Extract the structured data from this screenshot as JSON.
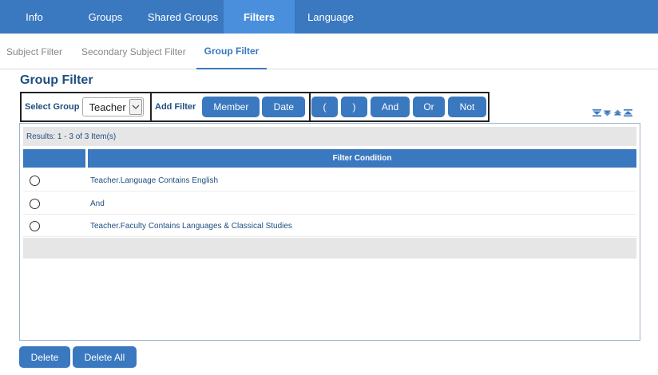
{
  "topnav": {
    "tabs": [
      {
        "label": "Info",
        "active": false
      },
      {
        "label": "Groups",
        "active": false
      },
      {
        "label": "Shared Groups",
        "active": false
      },
      {
        "label": "Filters",
        "active": true
      },
      {
        "label": "Language",
        "active": false
      }
    ]
  },
  "subtabs": [
    {
      "label": "Subject Filter",
      "active": false
    },
    {
      "label": "Secondary Subject Filter",
      "active": false
    },
    {
      "label": "Group Filter",
      "active": true
    }
  ],
  "page_title": "Group Filter",
  "toolbar": {
    "select_group_label": "Select Group",
    "select_group_value": "Teacher",
    "add_filter_label": "Add Filter",
    "member_label": "Member",
    "date_label": "Date",
    "open_paren_label": "(",
    "close_paren_label": ")",
    "and_label": "And",
    "or_label": "Or",
    "not_label": "Not"
  },
  "grid": {
    "results_text": "Results: 1 - 3 of 3 Item(s)",
    "column_header": "Filter Condition",
    "rows": [
      {
        "condition": "Teacher.Language Contains English"
      },
      {
        "condition": "And"
      },
      {
        "condition": "Teacher.Faculty Contains Languages & Classical Studies"
      }
    ]
  },
  "actions": {
    "delete_label": "Delete",
    "delete_all_label": "Delete All"
  },
  "colors": {
    "brand": "#3a78bf",
    "active_tab": "#4a8fdb",
    "title": "#1f4e80"
  }
}
